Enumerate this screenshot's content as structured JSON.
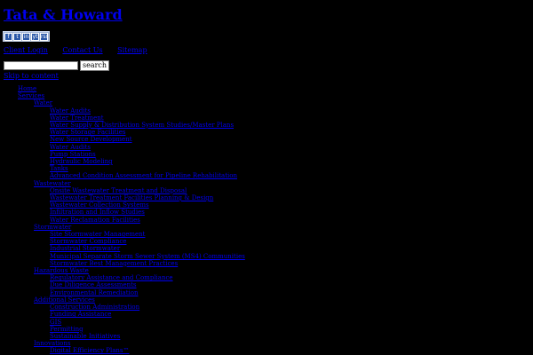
{
  "site": {
    "title": "Tata & Howard"
  },
  "social": {
    "icons": [
      "f",
      "t",
      "in",
      "yt",
      "rss"
    ]
  },
  "top_links": {
    "client_login": "Client Login",
    "contact_us": "Contact Us",
    "sitemap": "Sitemap"
  },
  "search": {
    "placeholder": "",
    "value": "",
    "button_label": "search"
  },
  "skip_link": "Skip to content",
  "nav": {
    "home": "Home",
    "services": "Services",
    "water": {
      "label": "Water",
      "items": [
        "Water Audits",
        "Water Treatment",
        "Water Supply & Distribution System Studies/Master Plans",
        "Water Storage Facilities",
        "New Source Development",
        "Water Audits",
        "Pump Stations",
        "Hydraulic Modeling",
        "Tanks",
        "Advanced Condition Assessment for Pipeline Rehabilitation"
      ]
    },
    "wastewater": {
      "label": "Wastewater",
      "items": [
        "Onsite Wastewater Treatment and Disposal",
        "Wastewater Treatment Facilities Planning & Design",
        "Wastewater Collection Systems",
        "Infiltration and Inflow Studies",
        "Water Reclamation Facilities"
      ]
    },
    "stormwater": {
      "label": "Stormwater",
      "items": [
        "Site Stormwater Management",
        "Stormwater Compliance",
        "Industrial Stormwater",
        "Municipal Separate Storm Sewer System (MS4) Communities",
        "Stormwater Best Management Practices"
      ]
    },
    "hazardous_waste": {
      "label": "Hazardous Waste",
      "items": [
        "Regulatory Assistance and Compliance",
        "Due Diligence Assessments",
        "Environmental Remediation"
      ]
    },
    "additional_services": {
      "label": "Additional Services",
      "items": [
        "Construction Administration",
        "Funding Assistance",
        "GIS",
        "Permitting",
        "Sustainable Initiatives"
      ]
    },
    "innovations": {
      "label": "Innovations",
      "items": [
        "Digital Efficiency Plans™"
      ]
    }
  }
}
